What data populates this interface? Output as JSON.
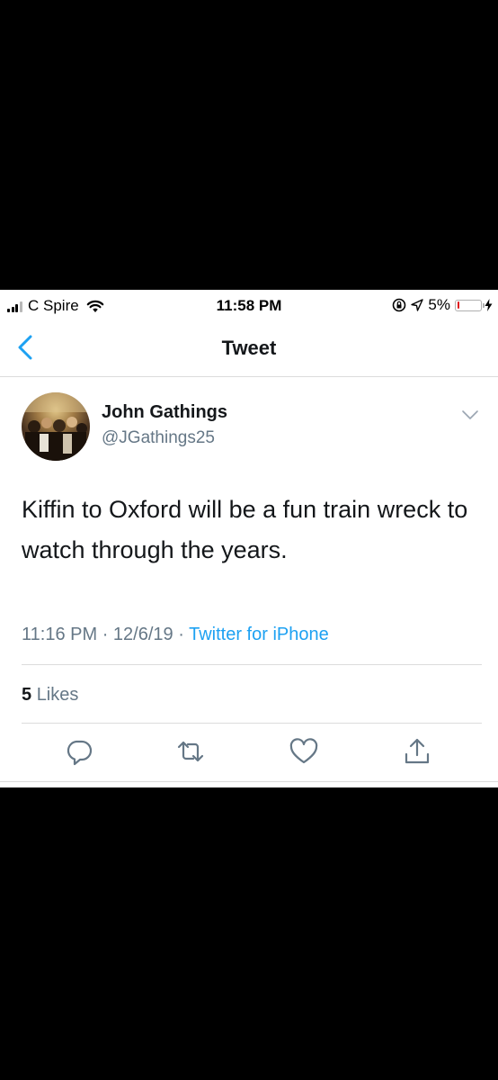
{
  "status_bar": {
    "carrier": "C Spire",
    "time": "11:58 PM",
    "battery_percent": "5%",
    "battery_level": 0.05,
    "icons": [
      "signal-icon",
      "wifi-icon",
      "orientation-lock-icon",
      "location-arrow-icon",
      "battery-icon",
      "charging-bolt-icon"
    ]
  },
  "nav": {
    "title": "Tweet",
    "back_icon": "chevron-left-icon"
  },
  "tweet": {
    "author_name": "John Gathings",
    "author_handle": "@JGathings25",
    "text": "Kiffin to Oxford will be a fun train wreck to watch through the years.",
    "time": "11:16 PM",
    "date": "12/6/19",
    "separator": "·",
    "source": "Twitter for iPhone",
    "likes_count": "5",
    "likes_label": "Likes",
    "menu_icon": "chevron-down-icon"
  },
  "actions": [
    {
      "name": "reply-icon"
    },
    {
      "name": "retweet-icon"
    },
    {
      "name": "like-icon"
    },
    {
      "name": "share-icon"
    }
  ],
  "colors": {
    "background_outer": "#000000",
    "screen": "#ffffff",
    "accent": "#1da1f2",
    "text_primary": "#14171a",
    "text_secondary": "#657786",
    "divider": "#dcdcdc",
    "battery_low": "#e0141a"
  }
}
